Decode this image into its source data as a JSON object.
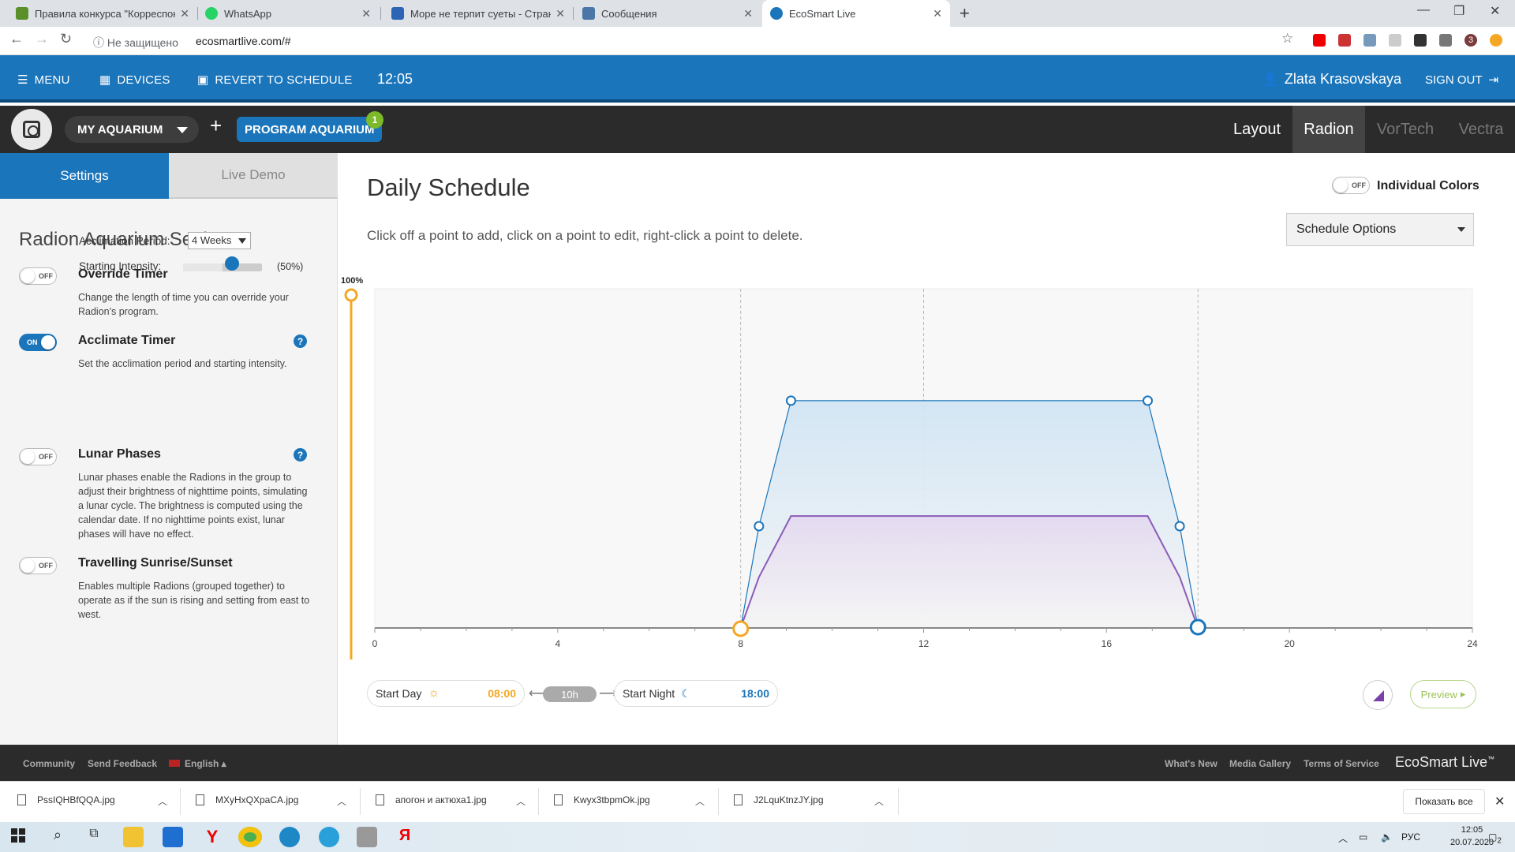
{
  "browser": {
    "tabs": [
      {
        "title": "Правила конкурса \"Корреспон",
        "active": false,
        "color": "#5a8f29"
      },
      {
        "title": "WhatsApp",
        "active": false,
        "color": "#25d366"
      },
      {
        "title": "Море не терпит суеты - Страни",
        "active": false,
        "color": "#2d64b3"
      },
      {
        "title": "Сообщения",
        "active": false,
        "color": "#4a76a8"
      },
      {
        "title": "EcoSmart Live",
        "active": true,
        "color": "#1b75bb"
      }
    ],
    "security": "Не защищено",
    "url": "ecosmartlive.com/#",
    "profile_badge": "3"
  },
  "header": {
    "menu": "MENU",
    "devices": "DEVICES",
    "revert": "REVERT TO SCHEDULE",
    "time": "12:05",
    "user": "Zlata Krasovskaya",
    "signout": "SIGN OUT"
  },
  "toolbar": {
    "aquarium": "MY AQUARIUM",
    "plus": "+",
    "program": "PROGRAM AQUARIUM",
    "program_badge": "1",
    "tabs": [
      "Layout",
      "Radion",
      "VorTech",
      "Vectra"
    ],
    "active_tab": "Radion"
  },
  "sidebar": {
    "tab_settings": "Settings",
    "tab_demo": "Live Demo",
    "title": "Radion Aquarium Settings",
    "override": {
      "name": "Override Timer",
      "state": "OFF",
      "desc": "Change the length of time you can override your Radion's program."
    },
    "acclimate": {
      "name": "Acclimate Timer",
      "state": "ON",
      "desc": "Set the acclimation period and starting intensity.",
      "period_label": "Acclimation Period:",
      "period_value": "4 Weeks",
      "intensity_label": "Starting Intensity:",
      "intensity_value": "(50%)",
      "intensity": 0.5
    },
    "lunar": {
      "name": "Lunar Phases",
      "state": "OFF",
      "desc": "Lunar phases enable the Radions in the group to adjust their brightness of nighttime points, simulating a lunar cycle. The brightness is computed using the calendar date. If no nighttime points exist, lunar phases will have no effect."
    },
    "travel": {
      "name": "Travelling Sunrise/Sunset",
      "state": "OFF",
      "desc": "Enables multiple Radions (grouped together) to operate as if the sun is rising and setting from east to west."
    },
    "help": "?"
  },
  "main": {
    "title": "Daily Schedule",
    "subtitle": "Click off a point to add, click on a point to edit, right-click a point to delete.",
    "individual_colors": "Individual Colors",
    "individual_state": "OFF",
    "schedule_options": "Schedule Options",
    "start_day_label": "Start Day",
    "start_day_time": "08:00",
    "duration": "10h",
    "start_night_label": "Start Night",
    "start_night_time": "18:00",
    "preview": "Preview",
    "arrow_left": "⟵",
    "arrow_right": "⟶"
  },
  "chart_data": {
    "type": "area",
    "title": "",
    "ymax_label": "100%",
    "xlim": [
      0,
      24
    ],
    "ylim": [
      0,
      100
    ],
    "xticks": [
      0,
      4,
      8,
      12,
      16,
      20,
      24
    ],
    "master_intensity": 100,
    "series": [
      {
        "name": "",
        "color": "#1b75bb",
        "fill": "#cfe4f4",
        "x": [
          0,
          8,
          8.4,
          9.1,
          16.9,
          17.6,
          18,
          24
        ],
        "y": [
          0,
          0,
          30,
          67,
          67,
          30,
          0,
          0
        ],
        "handles": [
          [
            8.4,
            30
          ],
          [
            9.1,
            67
          ],
          [
            16.9,
            67
          ],
          [
            17.6,
            30
          ]
        ]
      },
      {
        "name": "",
        "color": "#8a5cb8",
        "fill": "#e3d4ee",
        "x": [
          0,
          8,
          8.4,
          9.1,
          16.9,
          17.6,
          18,
          24
        ],
        "y": [
          0,
          0,
          15,
          33,
          33,
          15,
          0,
          0
        ]
      }
    ],
    "markers": {
      "start_day": 8,
      "start_night": 18
    },
    "grid": true
  },
  "footer": {
    "community": "Community",
    "feedback": "Send Feedback",
    "language": "English",
    "whats_new": "What's New",
    "media": "Media Gallery",
    "terms": "Terms of Service",
    "brand": "EcoSmart Live",
    "brand_tm": "™"
  },
  "downloads": {
    "files": [
      "PssIQHBfQQA.jpg",
      "MXyHxQXpaCA.jpg",
      "апогон и актюха1.jpg",
      "Kwyx3tbpmOk.jpg",
      "J2LquKtnzJY.jpg"
    ],
    "show_all": "Показать все"
  },
  "taskbar": {
    "lang": "РУС",
    "time": "12:05",
    "date": "20.07.2020",
    "notifications": "2"
  }
}
